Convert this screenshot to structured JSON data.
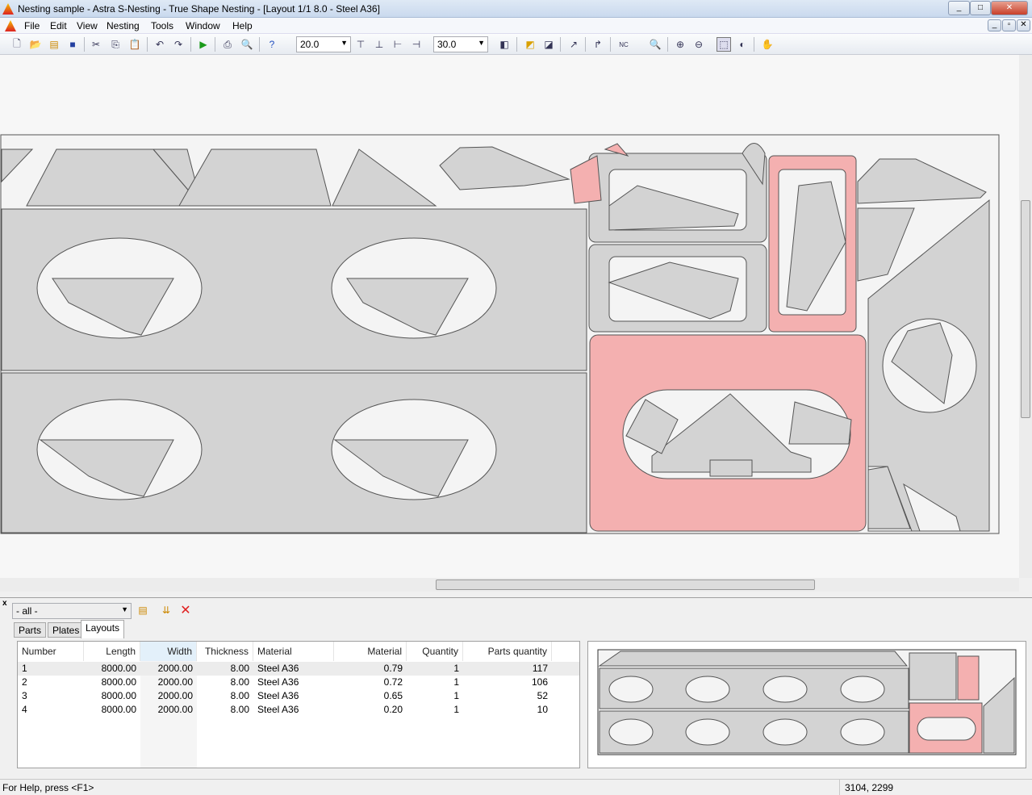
{
  "window": {
    "title": "Nesting sample - Astra S-Nesting - True Shape Nesting - [Layout 1/1 8.0 - Steel A36]",
    "controls": [
      "_",
      "□",
      "✕"
    ],
    "mdi_controls": [
      "_",
      "▫",
      "✕"
    ]
  },
  "menu": [
    "File",
    "Edit",
    "View",
    "Nesting",
    "Tools",
    "Window",
    "Help"
  ],
  "toolbar": {
    "spacing_value": "20.0",
    "angle_value": "30.0",
    "icons": [
      "new-icon",
      "open-icon",
      "properties-icon",
      "save-icon",
      "cut-icon",
      "copy-icon",
      "paste-icon",
      "undo-icon",
      "redo-icon",
      "run-nesting-icon",
      "print-icon",
      "print-preview-icon",
      "help-icon",
      "align-top-icon",
      "align-bottom-icon",
      "align-left-icon",
      "align-right-icon",
      "mirror-icon",
      "add-part-icon",
      "remove-part-icon",
      "path-icon",
      "redo-arrow-icon",
      "nc-icon",
      "zoom-page-icon",
      "zoom-in-icon",
      "zoom-out-icon",
      "zoom-window-icon",
      "zoom-all-icon",
      "pan-hand-icon"
    ]
  },
  "colors": {
    "part": "#d3d3d3",
    "selected_part": "#f4b0b0",
    "sheet_bg": "#f4f4f4",
    "delete": "#e02020"
  },
  "panel": {
    "filter_value": "- all -",
    "tabs": [
      "Parts",
      "Plates",
      "Layouts"
    ],
    "active_tab": "Layouts",
    "columns": [
      "Number",
      "Length",
      "Width",
      "Thickness",
      "Material",
      "Material Utiliza...",
      "Quantity",
      "Parts quantity"
    ],
    "sorted_column": "Width",
    "rows": [
      [
        "1",
        "8000.00",
        "2000.00",
        "8.00",
        "Steel A36",
        "0.79",
        "1",
        "117"
      ],
      [
        "2",
        "8000.00",
        "2000.00",
        "8.00",
        "Steel A36",
        "0.72",
        "1",
        "106"
      ],
      [
        "3",
        "8000.00",
        "2000.00",
        "8.00",
        "Steel A36",
        "0.65",
        "1",
        "52"
      ],
      [
        "4",
        "8000.00",
        "2000.00",
        "8.00",
        "Steel A36",
        "0.20",
        "1",
        "10"
      ]
    ]
  },
  "status": {
    "help": "For Help, press <F1>",
    "coords": "3104, 2299"
  }
}
